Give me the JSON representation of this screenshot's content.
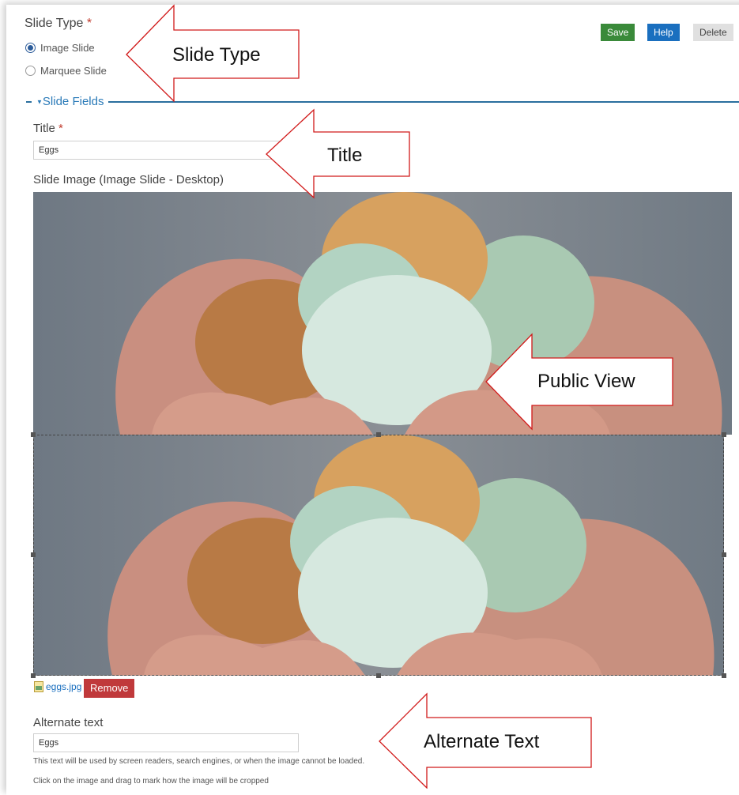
{
  "slide_type": {
    "label": "Slide Type",
    "required_mark": "*",
    "options": [
      {
        "label": "Image Slide",
        "checked": true
      },
      {
        "label": "Marquee Slide",
        "checked": false
      }
    ]
  },
  "toolbar": {
    "save_label": "Save",
    "help_label": "Help",
    "delete_label": "Delete"
  },
  "fieldset": {
    "legend": "Slide Fields",
    "toggle_icon": "caret-down-icon"
  },
  "title_field": {
    "label": "Title",
    "required_mark": "*",
    "value": "Eggs"
  },
  "slide_image": {
    "label": "Slide Image (Image Slide - Desktop)",
    "file_name": "eggs.jpg",
    "file_icon": "image-file-icon",
    "remove_label": "Remove"
  },
  "alt_text": {
    "label": "Alternate text",
    "value": "Eggs",
    "help": "This text will be used by screen readers, search engines, or when the image cannot be loaded.",
    "crop_hint": "Click on the image and drag to mark how the image will be cropped"
  },
  "callouts": {
    "slide_type": "Slide Type",
    "title": "Title",
    "public_view": "Public View",
    "alternate_text": "Alternate Text"
  },
  "colors": {
    "accent_blue": "#2a7ab8",
    "save_green": "#3a8a3a",
    "help_blue": "#1a6fbf",
    "remove_red": "#c0393b",
    "callout_red": "#d11a1a"
  }
}
